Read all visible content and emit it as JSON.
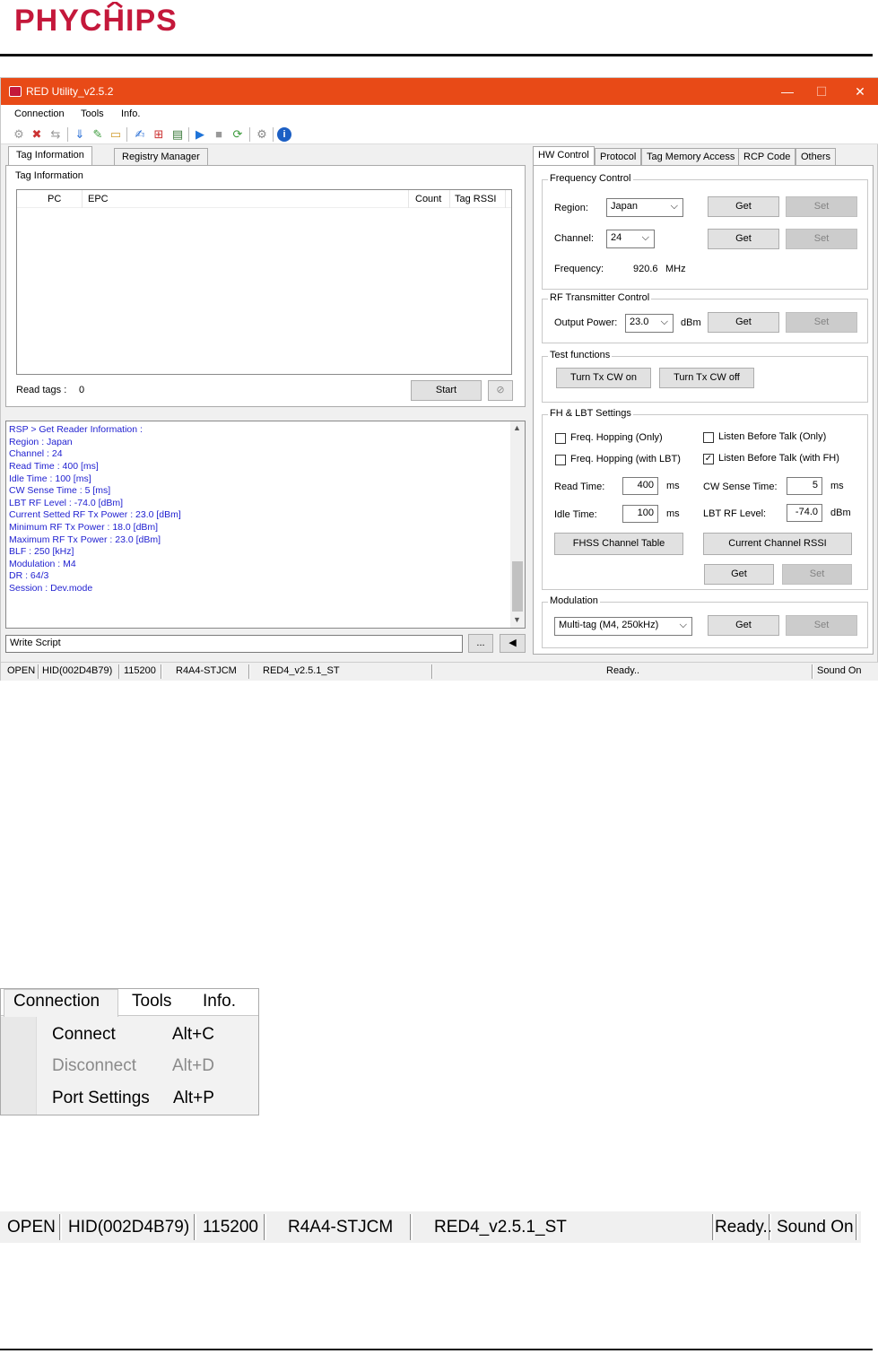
{
  "header": {
    "logo_text": "PHYCHIPS"
  },
  "window": {
    "title": "RED Utility_v2.5.2",
    "menu": [
      "Connection",
      "Tools",
      "Info."
    ],
    "controls": {
      "minimize": "—",
      "maximize": "☐",
      "close": "✕"
    }
  },
  "left_tabs": [
    "Tag Information",
    "Registry Manager"
  ],
  "tag_info": {
    "group_title": "Tag Information",
    "columns": [
      "PC",
      "EPC",
      "Count",
      "Tag RSSI"
    ],
    "read_tags_label": "Read tags :",
    "read_tags_value": "0",
    "start_button": "Start"
  },
  "log_lines": [
    "RSP > Get Reader Information :",
    "Region : Japan",
    "Channel : 24",
    "Read Time : 400 [ms]",
    "Idle Time : 100 [ms]",
    "CW Sense Time : 5 [ms]",
    "LBT RF Level : -74.0 [dBm]",
    "Current Setted RF Tx Power : 23.0 [dBm]",
    "Minimum RF Tx Power : 18.0 [dBm]",
    "Maximum RF Tx Power : 23.0 [dBm]",
    "BLF : 250 [kHz]",
    "Modulation : M4",
    "DR : 64/3",
    "Session : Dev.mode"
  ],
  "script": {
    "value": "Write Script",
    "browse": "...",
    "run": "◀"
  },
  "right_tabs": [
    "HW Control",
    "Protocol",
    "Tag Memory Access",
    "RCP Code",
    "Others"
  ],
  "freq_control": {
    "title": "Frequency Control",
    "region_label": "Region:",
    "region_value": "Japan",
    "channel_label": "Channel:",
    "channel_value": "24",
    "frequency_label": "Frequency:",
    "frequency_value": "920.6",
    "frequency_unit": "MHz",
    "get": "Get",
    "set": "Set"
  },
  "rf_tx": {
    "title": "RF Transmitter  Control",
    "power_label": "Output Power:",
    "power_value": "23.0",
    "power_unit": "dBm",
    "get": "Get",
    "set": "Set"
  },
  "test_functions": {
    "title": "Test functions",
    "cw_on": "Turn Tx CW on",
    "cw_off": "Turn Tx CW off"
  },
  "fh_lbt": {
    "title": "FH & LBT Settings",
    "freq_hop_only": "Freq. Hopping (Only)",
    "freq_hop_lbt": "Freq. Hopping (with LBT)",
    "lbt_only": "Listen Before Talk (Only)",
    "lbt_fh": "Listen Before Talk (with FH)",
    "lbt_fh_checked": "✓",
    "read_time_label": "Read Time:",
    "read_time_value": "400",
    "read_time_unit": "ms",
    "idle_time_label": "Idle Time:",
    "idle_time_value": "100",
    "idle_time_unit": "ms",
    "cw_sense_label": "CW Sense Time:",
    "cw_sense_value": "5",
    "cw_sense_unit": "ms",
    "lbt_level_label": "LBT RF Level:",
    "lbt_level_value": "-74.0",
    "lbt_level_unit": "dBm",
    "fhss_table": "FHSS Channel Table",
    "current_rssi": "Current Channel RSSI",
    "get": "Get",
    "set": "Set"
  },
  "modulation": {
    "title": "Modulation",
    "value": "Multi-tag (M4, 250kHz)",
    "get": "Get",
    "set": "Set"
  },
  "status": {
    "state": "OPEN",
    "device": "HID(002D4B79)",
    "baud": "115200",
    "model": "R4A4-STJCM",
    "firmware": "RED4_v2.5.1_ST",
    "ready": "Ready..",
    "sound": "Sound On"
  },
  "menu_zoom": {
    "bar": [
      "Connection",
      "Tools",
      "Info."
    ],
    "items": [
      {
        "label": "Connect",
        "shortcut": "Alt+C"
      },
      {
        "label": "Disconnect",
        "shortcut": "Alt+D"
      },
      {
        "label": "Port Settings",
        "shortcut": "Alt+P"
      }
    ]
  },
  "status_zoom": {
    "state": "OPEN",
    "device": "HID(002D4B79)",
    "baud": "115200",
    "model": "R4A4-STJCM",
    "firmware": "RED4_v2.5.1_ST",
    "ready": "Ready..",
    "sound": "Sound On"
  },
  "colors": {
    "titlebar": "#e84a17",
    "logo": "#c4183b",
    "log_text": "#1f1fd0"
  }
}
